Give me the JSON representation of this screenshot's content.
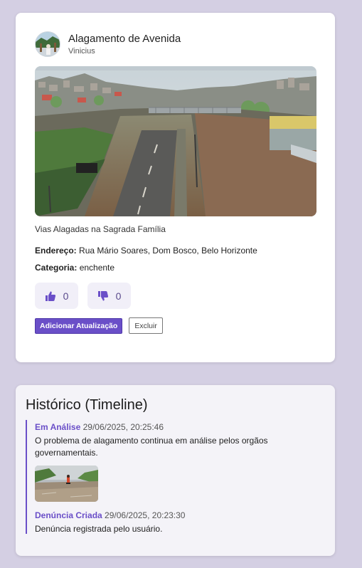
{
  "report": {
    "title": "Alagamento de Avenida",
    "author": "Vinicius",
    "photo_icon": "flooded-avenue-photo",
    "caption": "Vias Alagadas na Sagrada Família",
    "address_label": "Endereço:",
    "address_value": "Rua Mário Soares, Dom Bosco, Belo Horizonte",
    "category_label": "Categoria:",
    "category_value": "enchente",
    "likes": "0",
    "dislikes": "0",
    "add_update_label": "Adicionar Atualização",
    "delete_label": "Excluir"
  },
  "timeline": {
    "title": "Histórico (Timeline)",
    "items": [
      {
        "status": "Em Análise",
        "date": "29/06/2025, 20:25:46",
        "text": "O problema de alagamento continua em análise pelos orgãos governamentais."
      },
      {
        "status": "Denúncia Criada",
        "date": "29/06/2025, 20:23:30",
        "text": "Denúncia registrada pelo usuário."
      }
    ]
  },
  "colors": {
    "accent": "#6a4fc8",
    "background": "#d4cfe3",
    "card": "#ffffff",
    "timeline_card": "#f4f3f8"
  }
}
